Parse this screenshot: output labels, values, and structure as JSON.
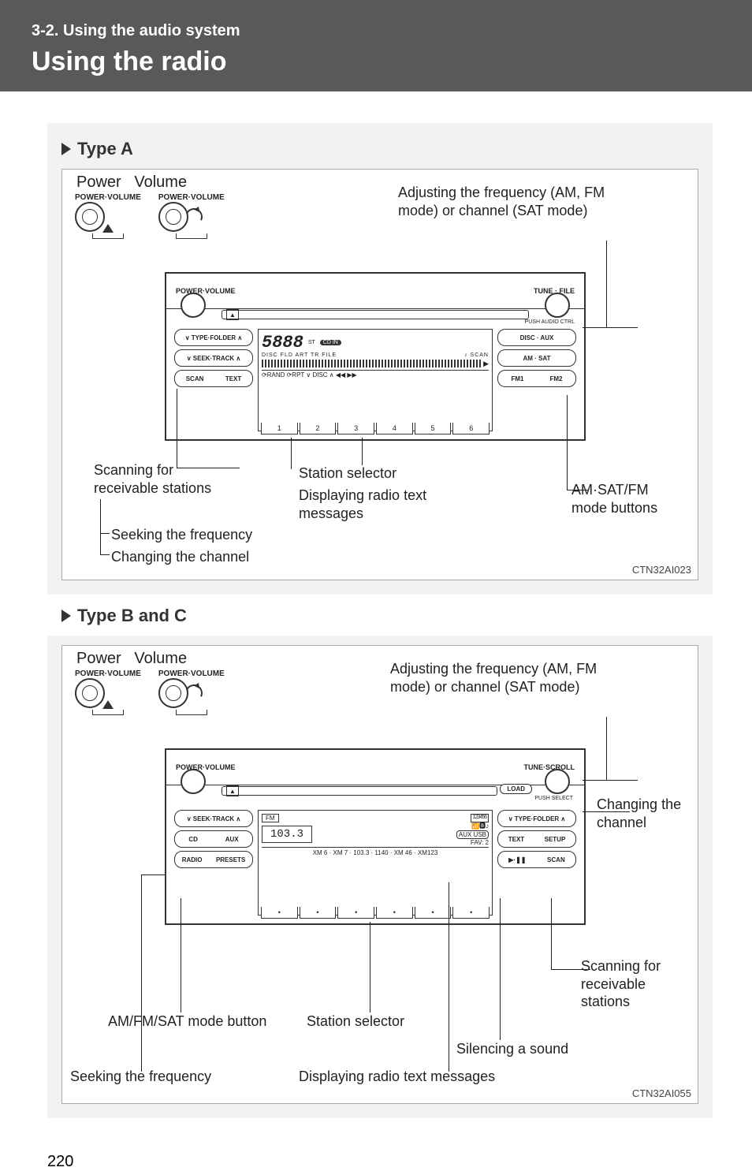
{
  "header": {
    "section": "3-2. Using the audio system",
    "title": "Using the radio"
  },
  "typeA": {
    "label": "Type A",
    "power": "Power",
    "volume": "Volume",
    "power_volume_small": "POWER·VOLUME",
    "adjusting": "Adjusting the frequency (AM, FM mode) or channel (SAT mode)",
    "scanning": "Scanning for\nreceivable stations",
    "station_selector": "Station selector",
    "displaying": "Displaying radio text messages",
    "seeking": "Seeking the frequency",
    "changing": "Changing the channel",
    "amsatfm": "AM·SAT/FM mode buttons",
    "ref": "CTN32AI023",
    "unit": {
      "left_knob": "POWER·VOLUME",
      "right_knob": "TUNE · FILE",
      "push_audio": "PUSH\nAUDIO CTRL",
      "left_btns": [
        "∨  TYPE·FOLDER  ∧",
        "∨  SEEK·TRACK  ∧"
      ],
      "left_btns_split": {
        "scan": "SCAN",
        "text": "TEXT"
      },
      "right_btns": [
        "DISC · AUX",
        "AM · SAT"
      ],
      "right_btns_split": {
        "fm1": "FM1",
        "fm2": "FM2"
      },
      "presets": [
        "1",
        "2",
        "3",
        "4",
        "5",
        "6"
      ],
      "display_freq": "5888",
      "display_icons": "CD IN",
      "display_row": "DISC  FLD ART TR FILE",
      "display_lower": "⟳RAND  ⟳RPT    ∨ DISC ∧    ◀◀   ▶▶",
      "display_st": "ST",
      "display_scan": "♪ SCAN"
    }
  },
  "typeBC": {
    "label": "Type B and C",
    "power": "Power",
    "volume": "Volume",
    "power_volume_small": "POWER·VOLUME",
    "adjusting": "Adjusting the frequency (AM, FM mode) or channel (SAT mode)",
    "changing": "Changing the channel",
    "scanning": "Scanning for receivable stations",
    "amfmsat": "AM/FM/SAT mode button",
    "station_selector": "Station selector",
    "silencing": "Silencing a sound",
    "seeking": "Seeking the frequency",
    "displaying": "Displaying radio text messages",
    "ref": "CTN32AI055",
    "unit": {
      "left_knob": "POWER·VOLUME",
      "right_knob": "TUNE·SCROLL",
      "push_select": "PUSH\nSELECT",
      "load": "LOAD",
      "left_btns": [
        "∨  SEEK·TRACK  ∧"
      ],
      "left_btns_split1": {
        "cd": "CD",
        "aux": "AUX"
      },
      "left_btns_split2": {
        "radio": "RADIO",
        "presets": "PRESETS"
      },
      "right_btns": [
        "∨ TYPE·FOLDER ∧"
      ],
      "right_btns_split1": {
        "text": "TEXT",
        "setup": "SETUP"
      },
      "right_btns_split2": {
        "play": "▶·❚❚",
        "scan": "SCAN"
      },
      "presets": [
        "•",
        "•",
        "•",
        "•",
        "•",
        "•"
      ],
      "display_band": "FM",
      "display_freq": "103.3",
      "display_preset_ind": "123456",
      "display_icons": "📶🅱♪",
      "display_aux": "AUX USB",
      "display_fav": "FAV: 2",
      "display_lower": "XM 6 · XM 7 · 103.3 · 1140 · XM 46 · XM123"
    }
  },
  "page_number": "220"
}
